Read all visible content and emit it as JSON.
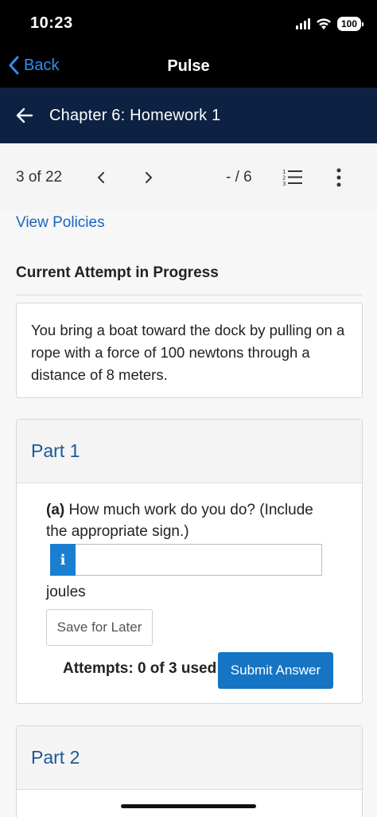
{
  "status_bar": {
    "time": "10:23",
    "battery": "100"
  },
  "nav": {
    "back_label": "Back",
    "title": "Pulse"
  },
  "chapter": {
    "title": "Chapter 6: Homework 1"
  },
  "question_nav": {
    "position": "3 of 22",
    "score": "- / 6"
  },
  "policies_link": "View Policies",
  "attempt_heading": "Current Attempt in Progress",
  "problem": {
    "text": "You bring a boat toward the dock by pulling on a rope with a force of 100 newtons through a distance of 8 meters."
  },
  "part1": {
    "title": "Part 1",
    "label": "(a)",
    "question": "How much work do you do? (Include the appropriate sign.)",
    "info_glyph": "i",
    "answer_value": "",
    "unit": "joules",
    "save_label": "Save for Later",
    "attempts": "Attempts: 0 of 3 used",
    "submit_label": "Submit Answer"
  },
  "part2": {
    "title": "Part 2"
  },
  "colors": {
    "chapter_bar": "#0d2142",
    "link_blue": "#1565c0",
    "submit_blue": "#1574c4",
    "info_blue": "#1a7fd0",
    "part_title": "#1a5a96"
  },
  "icons": {
    "back": "chevron-left-icon",
    "chapter_back": "arrow-left-icon",
    "prev": "chevron-left-icon",
    "next": "chevron-right-icon",
    "list": "numbered-list-icon",
    "more": "more-vertical-icon"
  }
}
